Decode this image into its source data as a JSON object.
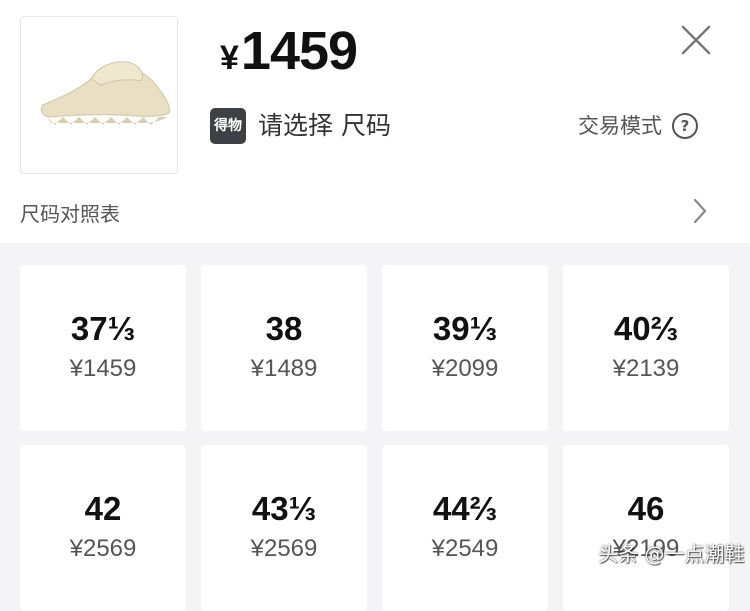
{
  "header": {
    "currency_symbol": "¥",
    "price": "1459",
    "brand_badge": "得物",
    "select_prompt": "请选择 尺码",
    "trade_mode_label": "交易模式",
    "help_glyph": "?",
    "size_chart_label": "尺码对照表"
  },
  "product_image": {
    "icon": "slide-sandal",
    "color": "#e6dcbf"
  },
  "sizes": [
    {
      "size": "37⅓",
      "price": "¥1459"
    },
    {
      "size": "38",
      "price": "¥1489"
    },
    {
      "size": "39⅓",
      "price": "¥2099"
    },
    {
      "size": "40⅔",
      "price": "¥2139"
    },
    {
      "size": "42",
      "price": "¥2569"
    },
    {
      "size": "43⅓",
      "price": "¥2569"
    },
    {
      "size": "44⅔",
      "price": "¥2549"
    },
    {
      "size": "46",
      "price": "¥2199"
    }
  ],
  "watermark": "头条 @一点潮鞋",
  "colors": {
    "page_bg": "#f4f4f6",
    "card_bg": "#ffffff",
    "badge_bg": "#3e4046"
  }
}
